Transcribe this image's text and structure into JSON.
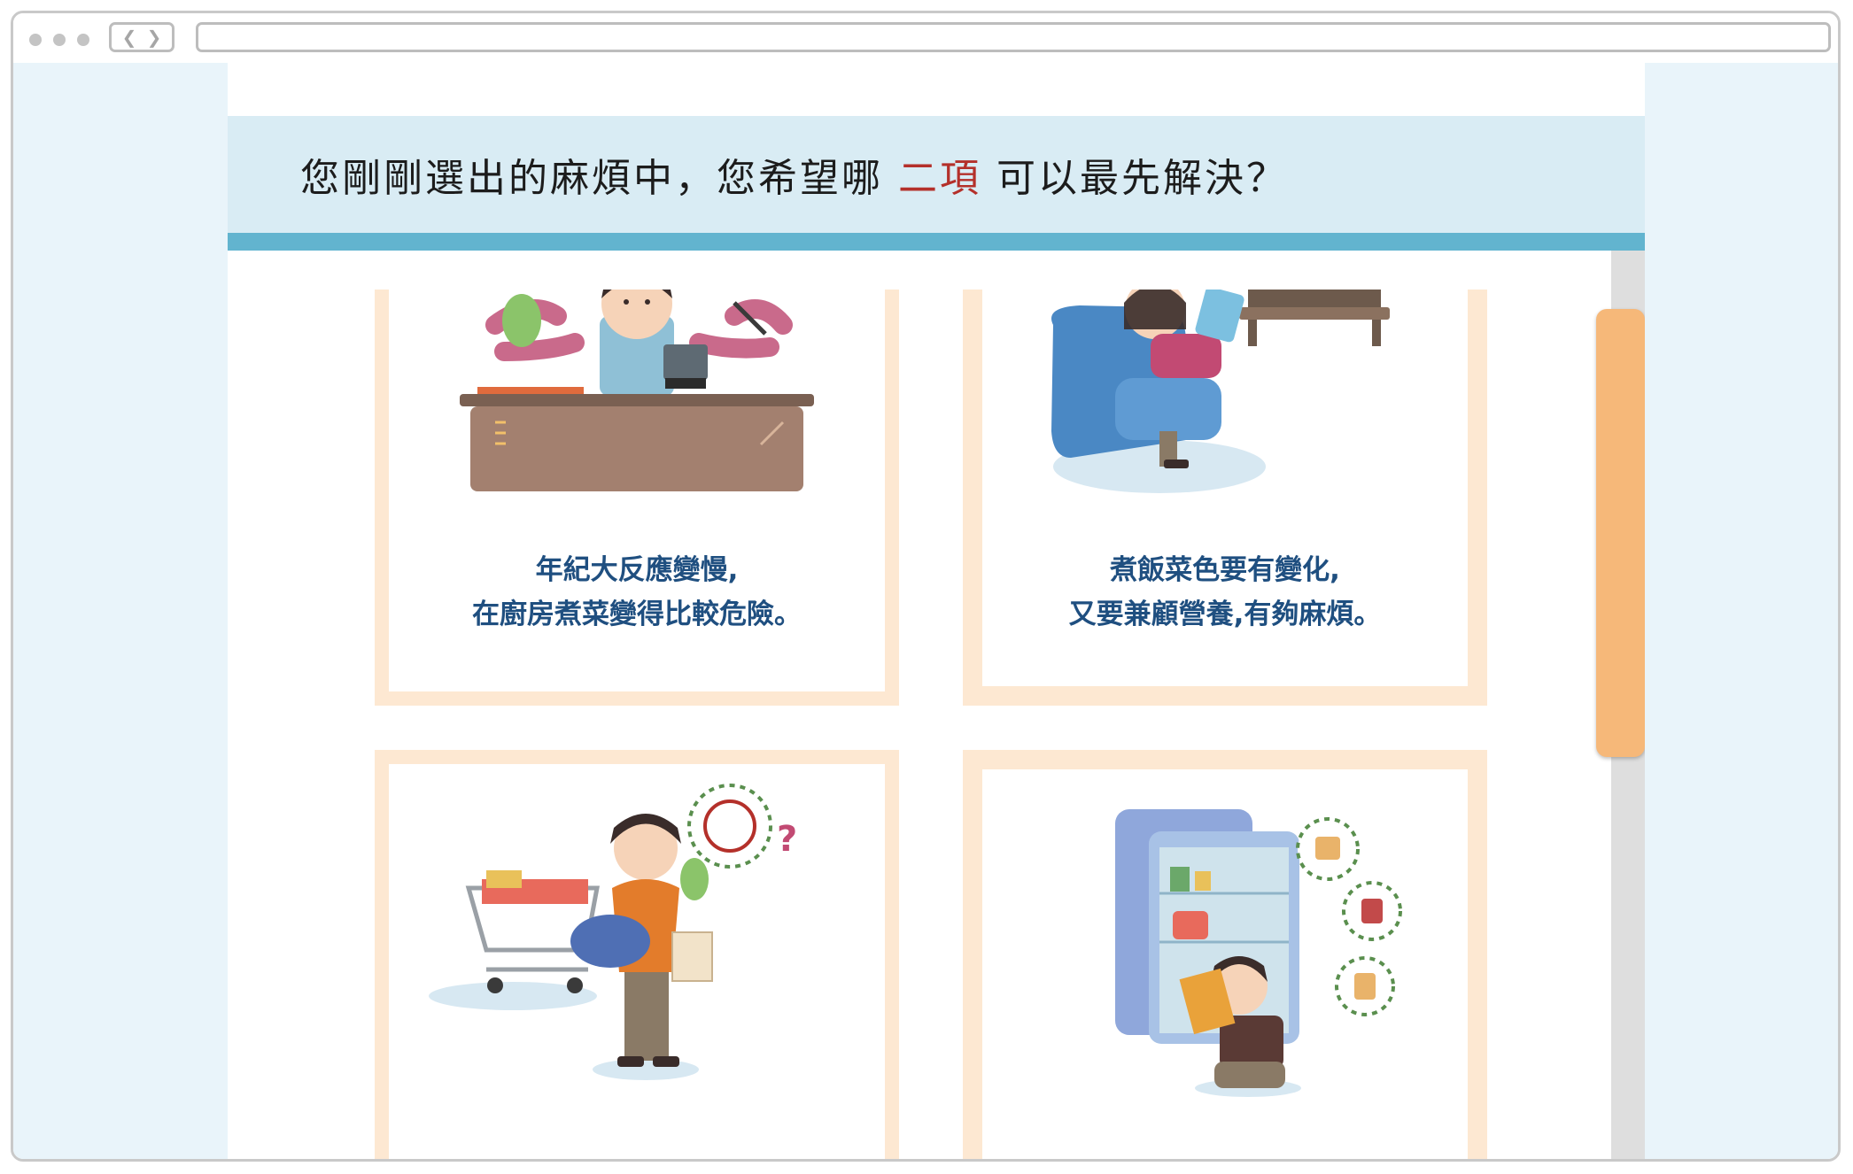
{
  "browser": {
    "back_glyph": "❮",
    "forward_glyph": "❯",
    "url": ""
  },
  "question": {
    "before": "您剛剛選出的麻煩中，您希望哪",
    "highlight": "二項",
    "after": "可以最先解決？"
  },
  "colors": {
    "accent_blue": "#62b4cf",
    "band_bg": "#d9ecf4",
    "highlight_red": "#b4302a",
    "card_border": "#fde8d2",
    "caption_blue": "#1f4f80",
    "scroll_thumb": "#f6b879"
  },
  "cards": [
    {
      "icon": "busy-cooking-grandma-icon",
      "line1": "年紀大反應變慢,",
      "line2": "在廚房煮菜變得比較危險。"
    },
    {
      "icon": "armchair-recipe-tablet-icon",
      "line1": "煮飯菜色要有變化,",
      "line2": "又要兼顧營養,有夠麻煩。"
    },
    {
      "icon": "grocery-shopping-organic-icon",
      "line1": "",
      "line2": ""
    },
    {
      "icon": "fridge-food-search-icon",
      "line1": "",
      "line2": ""
    }
  ]
}
